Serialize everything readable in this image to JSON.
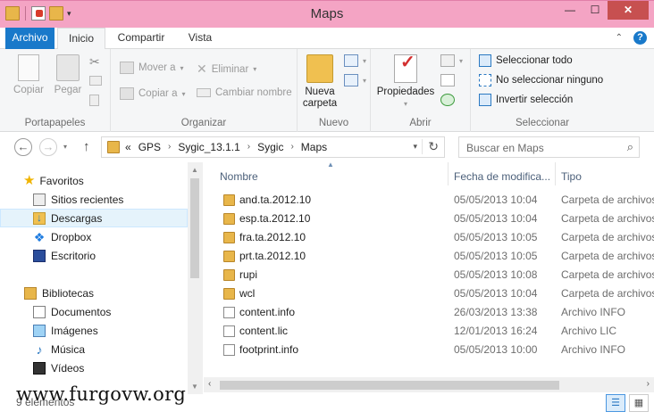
{
  "window": {
    "title": "Maps",
    "minimize": "—",
    "maximize": "☐",
    "close": "✕"
  },
  "ribbon_tabs": [
    "Archivo",
    "Inicio",
    "Compartir",
    "Vista"
  ],
  "ribbon": {
    "clipboard": {
      "copy": "Copiar",
      "paste": "Pegar",
      "label": "Portapapeles"
    },
    "organize": {
      "move_to": "Mover a",
      "copy_to": "Copiar a",
      "delete": "Eliminar",
      "rename": "Cambiar nombre",
      "label": "Organizar"
    },
    "new": {
      "new_folder_line1": "Nueva",
      "new_folder_line2": "carpeta",
      "label": "Nuevo"
    },
    "open": {
      "properties": "Propiedades",
      "label": "Abrir"
    },
    "select": {
      "select_all": "Seleccionar todo",
      "select_none": "No seleccionar ninguno",
      "invert": "Invertir selección",
      "label": "Seleccionar"
    }
  },
  "address": {
    "overflow": "«",
    "crumbs": [
      "GPS",
      "Sygic_13.1.1",
      "Sygic",
      "Maps"
    ],
    "search_placeholder": "Buscar en Maps"
  },
  "nav": {
    "favorites": "Favoritos",
    "recent": "Sitios recientes",
    "downloads": "Descargas",
    "dropbox": "Dropbox",
    "desktop": "Escritorio",
    "libraries": "Bibliotecas",
    "documents": "Documentos",
    "images": "Imágenes",
    "music": "Música",
    "videos": "Vídeos"
  },
  "columns": {
    "name": "Nombre",
    "date": "Fecha de modifica...",
    "type": "Tipo"
  },
  "files": [
    {
      "name": "and.ta.2012.10",
      "date": "05/05/2013 10:04",
      "type": "Carpeta de archivos",
      "kind": "folder"
    },
    {
      "name": "esp.ta.2012.10",
      "date": "05/05/2013 10:04",
      "type": "Carpeta de archivos",
      "kind": "folder"
    },
    {
      "name": "fra.ta.2012.10",
      "date": "05/05/2013 10:05",
      "type": "Carpeta de archivos",
      "kind": "folder"
    },
    {
      "name": "prt.ta.2012.10",
      "date": "05/05/2013 10:05",
      "type": "Carpeta de archivos",
      "kind": "folder"
    },
    {
      "name": "rupi",
      "date": "05/05/2013 10:08",
      "type": "Carpeta de archivos",
      "kind": "folder"
    },
    {
      "name": "wcl",
      "date": "05/05/2013 10:04",
      "type": "Carpeta de archivos",
      "kind": "folder"
    },
    {
      "name": "content.info",
      "date": "26/03/2013 13:38",
      "type": "Archivo INFO",
      "kind": "file"
    },
    {
      "name": "content.lic",
      "date": "12/01/2013 16:24",
      "type": "Archivo LIC",
      "kind": "file"
    },
    {
      "name": "footprint.info",
      "date": "05/05/2013 10:00",
      "type": "Archivo INFO",
      "kind": "file"
    }
  ],
  "status": {
    "count": "9 elementos"
  },
  "watermark": "www.furgovw.org",
  "colors": {
    "title_bar": "#f4a4c4",
    "file_tab": "#1979ca",
    "close_button": "#c75050",
    "folder": "#e8b64a",
    "selection": "#e5f3fb"
  }
}
